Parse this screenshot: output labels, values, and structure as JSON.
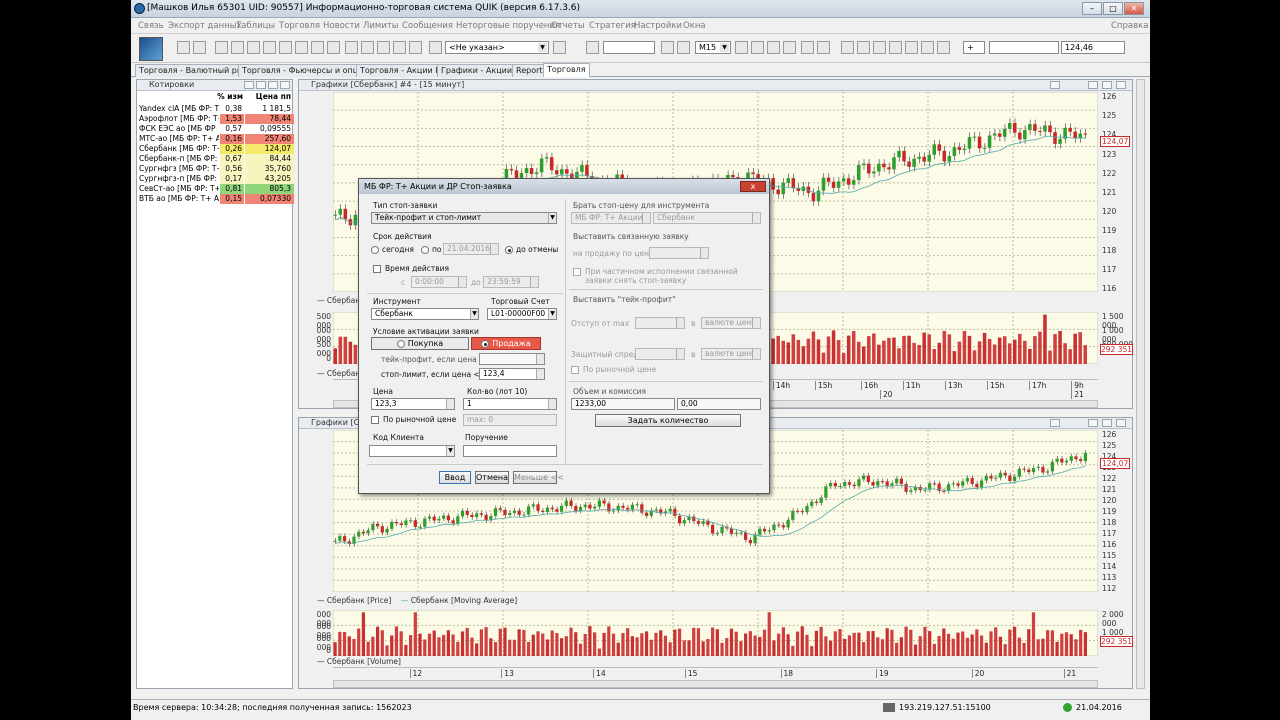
{
  "window": {
    "title": "[Машков Илья 65301 UID: 90557] Информационно-торговая система QUIK (версия 6.17.3.6)"
  },
  "menu": [
    "Связь",
    "Экспорт данных",
    "Таблицы",
    "Торговля",
    "Новости",
    "Лимиты",
    "Сообщения",
    "Неторговые поручения",
    "Отчеты",
    "Стратегия",
    "Настройки",
    "Окна"
  ],
  "menu_help": "Справка",
  "toolbar": {
    "account_select": "<Не указан>",
    "interval": "M15",
    "price_value": "124,46"
  },
  "tabs": [
    "Торговля - Валютный рынок",
    "Торговля - Фьючерсы и опционы",
    "Торговля - Акции РФ",
    "Графики - Акции РФ",
    "Reports",
    "Торговля"
  ],
  "quotes": {
    "title": "Котировки",
    "col_change": "% изм",
    "col_price": "Цена пп",
    "rows": [
      {
        "name": "Yandex clA [МБ ФР: Т+",
        "change": "0,38",
        "price": "1 181,5",
        "color": "none"
      },
      {
        "name": "Аэрофлот [МБ ФР: Т+",
        "change": "1,53",
        "price": "78,44",
        "color": "red"
      },
      {
        "name": "ФСК ЕЭС ао [МБ ФР",
        "change": "0,57",
        "price": "0,09555",
        "color": "none"
      },
      {
        "name": "МТС-ао [МБ ФР: Т+ А",
        "change": "0,16",
        "price": "257,60",
        "color": "red"
      },
      {
        "name": "Сбербанк [МБ ФР: Т+",
        "change": "0,26",
        "price": "124,07",
        "color": "yellow"
      },
      {
        "name": "Сбербанк-п [МБ ФР: Т",
        "change": "0,67",
        "price": "84,44",
        "color": "lightyellow"
      },
      {
        "name": "Сургнфгз [МБ ФР: Т+",
        "change": "0,56",
        "price": "35,760",
        "color": "lightyellow"
      },
      {
        "name": "Сургнфгз-п [МБ ФР: Т",
        "change": "0,17",
        "price": "43,205",
        "color": "lightyellow"
      },
      {
        "name": "СевСт-ао [МБ ФР: Т+ А",
        "change": "0,81",
        "price": "805,3",
        "color": "green"
      },
      {
        "name": "ВТБ ао [МБ ФР: Т+ Ак",
        "change": "0,15",
        "price": "0,07330",
        "color": "red"
      }
    ]
  },
  "chart1": {
    "title": "Графики [Сбербанк] #4 - [15 минут]",
    "y_ticks": [
      "126",
      "125",
      "124",
      "123",
      "122",
      "121",
      "120",
      "119",
      "118",
      "117",
      "116"
    ],
    "last_price": "124,07",
    "legend_price": "Сбербанк",
    "vol_ticks": [
      "1 500 000",
      "1 000 000",
      "500 000"
    ],
    "vol_ticks_left": [
      "500 000",
      "000 000",
      "500 000",
      "0"
    ],
    "last_vol": "292 351",
    "legend_vol": "Сбербанк",
    "x_labels": [
      "14h",
      "15h",
      "16h",
      "11h",
      "13h",
      "15h",
      "17h",
      "9h"
    ],
    "x_dates": [
      "20",
      "21"
    ]
  },
  "chart2": {
    "title": "Графики [Сбербанк]",
    "y_ticks": [
      "126",
      "125",
      "124",
      "123",
      "122",
      "121",
      "120",
      "119",
      "118",
      "117",
      "116",
      "115",
      "114",
      "113",
      "112"
    ],
    "last_price": "124,07",
    "legend_price": "Сбербанк [Price]",
    "legend_ma": "Сбербанк [Moving Average]",
    "vol_ticks": [
      "2 000 000",
      "1 000 000"
    ],
    "vol_ticks_left": [
      "000 000",
      "000 000",
      "000 000",
      "0"
    ],
    "last_vol": "292 351",
    "legend_vol": "Сбербанк [Volume]",
    "x_labels": [
      "12",
      "13",
      "14",
      "15",
      "18",
      "19",
      "20",
      "21"
    ]
  },
  "dialog": {
    "title": "МБ ФР: Т+ Акции и ДР Стоп-заявка",
    "close": "x",
    "type_label": "Тип стоп-заявки",
    "type_value": "Тейк-профит и стоп-лимит",
    "term_label": "Срок действия",
    "term_today": "сегодня",
    "term_until": "по",
    "term_date": "21.04.2016",
    "term_cancel": "до отмены",
    "time_label": "Время действия",
    "time_from_prefix": "с",
    "time_from": "0:00:00",
    "time_to_prefix": "до",
    "time_to": "23:59:59",
    "instr_label": "Инструмент",
    "instr_value": "Сбербанк",
    "account_label": "Торговый Счет",
    "account_value": "L01-00000F00",
    "cond_label": "Условие активации заявки",
    "buy": "Покупка",
    "sell": "Продажа",
    "tp_label": "тейк-профит, если цена >=",
    "sl_label": "стоп-лимит, если цена <=",
    "sl_value": "123,4",
    "price_label": "Цена",
    "price_value": "123,3",
    "qty_label": "Кол-во (лот 10)",
    "qty_value": "1",
    "market_label": "По рыночной цене",
    "max_label": "max: 0",
    "client_label": "Код Клиента",
    "order_label": "Поручение",
    "enter_btn": "Ввод",
    "cancel_btn": "Отмена",
    "less_btn": "Меньше <<",
    "r_take_label": "Брать стоп-цену для инструмента",
    "r_take_class": "МБ ФР: Т+ Акции и",
    "r_take_instr": "Сбербанк",
    "r_linked_label": "Выставить связанную заявку",
    "r_linked_price": "на продажу по цене",
    "r_partial": "При частичном исполнении связанной заявки снять стоп-заявку",
    "r_tp_label": "Выставить \"тейк-профит\"",
    "r_indent": "Отступ от max",
    "r_spread": "Защитный спред",
    "r_in": "в",
    "r_currency": "валюте цены",
    "r_market": "По рыночной цене",
    "r_volume_label": "Объем и комиссия",
    "r_volume": "1233,00",
    "r_commission": "0,00",
    "r_set_qty": "Задать количество"
  },
  "status": {
    "server_time": "Время сервера: 10:34:28; последняя полученная запись: 1562023",
    "ip": "193.219.127.51:15100",
    "date": "21.04.2016"
  }
}
